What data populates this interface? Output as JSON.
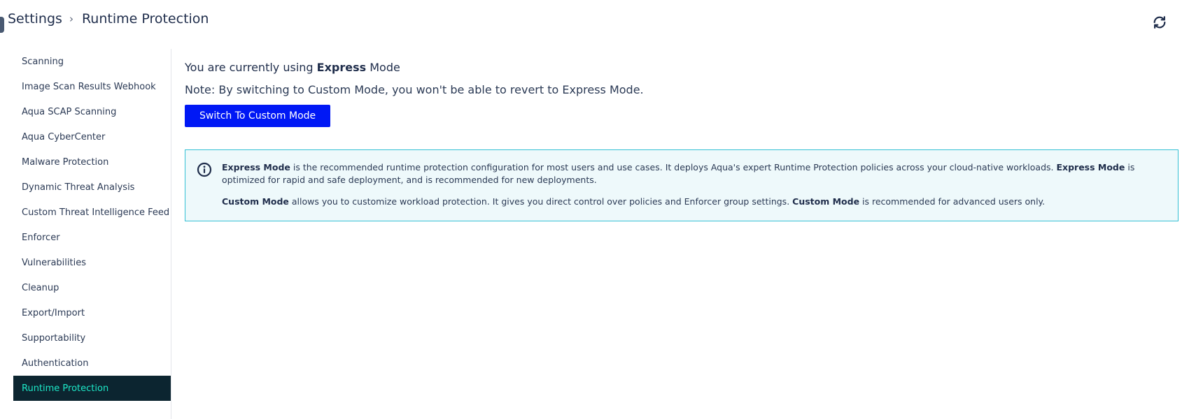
{
  "header": {
    "breadcrumb_root": "Settings",
    "breadcrumb_separator": "›",
    "breadcrumb_current": "Runtime Protection",
    "refresh_icon": "refresh-icon"
  },
  "sidebar": {
    "items": [
      {
        "label": "Scanning"
      },
      {
        "label": "Image Scan Results Webhook"
      },
      {
        "label": "Aqua SCAP Scanning"
      },
      {
        "label": "Aqua CyberCenter"
      },
      {
        "label": "Malware Protection"
      },
      {
        "label": "Dynamic Threat Analysis"
      },
      {
        "label": "Custom Threat Intelligence Feed"
      },
      {
        "label": "Enforcer"
      },
      {
        "label": "Vulnerabilities"
      },
      {
        "label": "Cleanup"
      },
      {
        "label": "Export/Import"
      },
      {
        "label": "Supportability"
      },
      {
        "label": "Authentication"
      },
      {
        "label": "Runtime Protection",
        "active": true
      }
    ]
  },
  "main": {
    "mode_prefix": "You are currently using ",
    "mode_name": "Express",
    "mode_suffix": " Mode",
    "note": "Note: By switching to Custom Mode, you won't be able to revert to Express Mode.",
    "switch_button": "Switch To Custom Mode",
    "info": {
      "icon": "info-icon",
      "p1_bold1": "Express Mode",
      "p1_text1": " is the recommended runtime protection configuration for most users and use cases. It deploys Aqua's expert Runtime Protection policies across your cloud-native workloads. ",
      "p1_bold2": "Express Mode",
      "p1_text2": " is optimized for rapid and safe deployment, and is recommended for new deployments.",
      "p2_bold1": "Custom Mode",
      "p2_text1": " allows you to customize workload protection. It gives you direct control over policies and Enforcer group settings. ",
      "p2_bold2": "Custom Mode",
      "p2_text2": " is recommended for advanced users only."
    }
  },
  "colors": {
    "primary_button": "#0018f5",
    "active_sidebar_bg": "#0c2530",
    "active_sidebar_text": "#1de9c8",
    "info_border": "#34c0d4",
    "info_bg": "#eef9fb"
  }
}
